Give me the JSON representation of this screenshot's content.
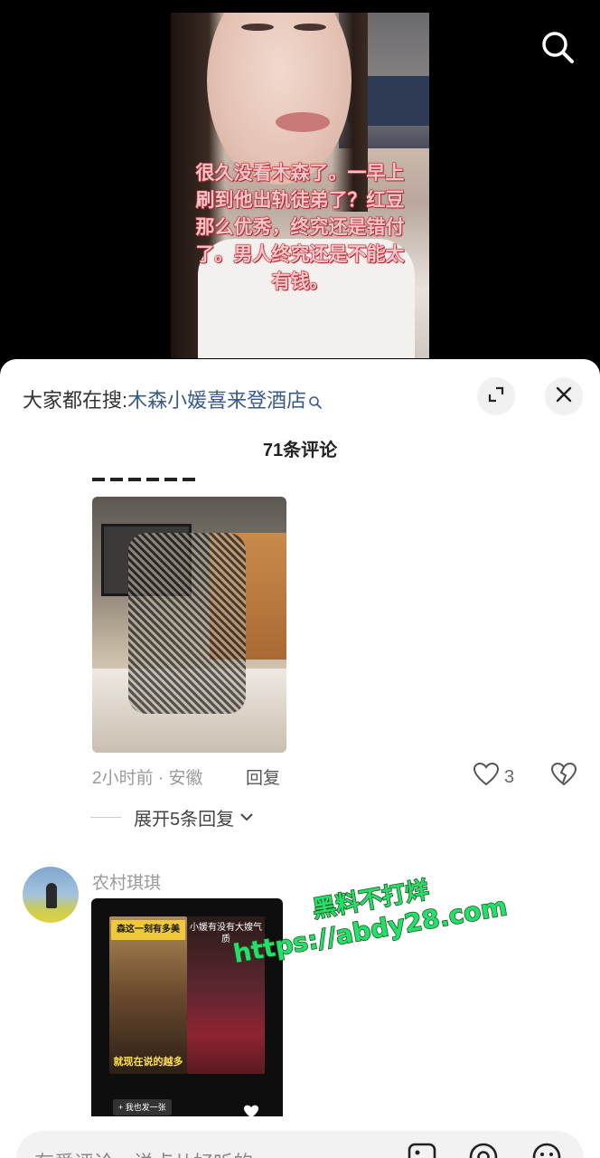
{
  "video": {
    "caption": "很久没看木森了。一早上\n刷到他出轨徒弟了？红豆\n那么优秀，终究还是错付\n了。男人终究还是不能太\n有钱。"
  },
  "sheet": {
    "hot_search_prefix": "大家都在搜:",
    "hot_search_term": "木森小媛喜来登酒店",
    "title": "71条评论"
  },
  "comment1": {
    "time_location": "2小时前 · 安徽",
    "reply_label": "回复",
    "like_count": "3",
    "expand_label": "展开5条回复"
  },
  "comment2": {
    "username": "农村琪琪",
    "image": {
      "banner_text": "森这一刻有多美",
      "right_text": "小媛有没有大嫂气质",
      "bottom_text": "就现在说的越多",
      "pill_text": "+ 我也发一张"
    }
  },
  "watermark": {
    "line1": "黑料不打烊",
    "line2": "https://abdy28.com"
  },
  "input": {
    "placeholder": "有爱评论，说点儿好听的"
  },
  "icons": {
    "top_search": "search-icon",
    "expand": "expand-icon",
    "close": "close-icon",
    "like": "heart-icon",
    "dislike": "broken-heart-icon",
    "image": "image-icon",
    "at": "at-icon",
    "emoji": "emoji-icon"
  }
}
